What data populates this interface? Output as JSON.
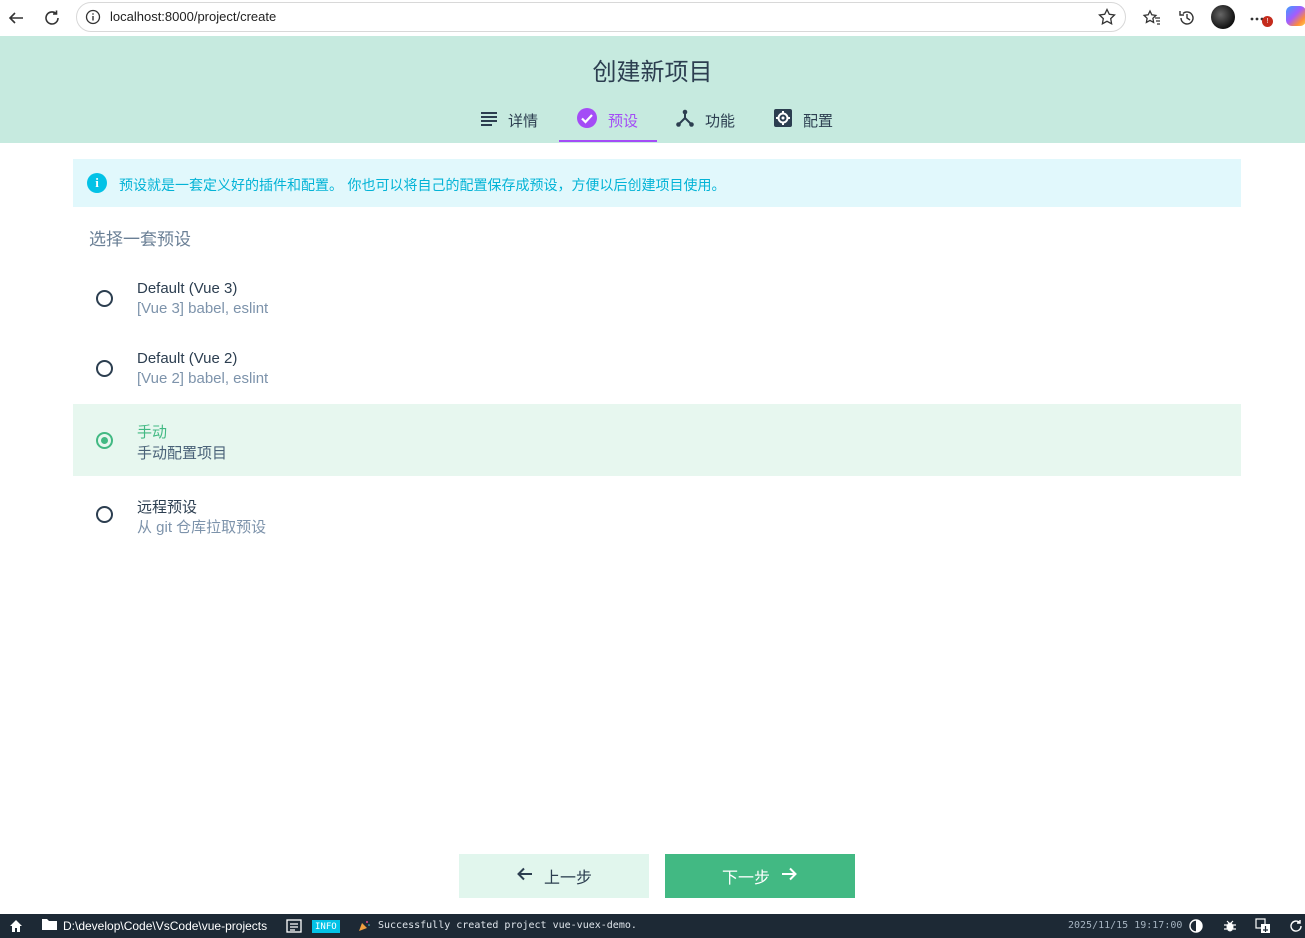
{
  "browser": {
    "url": "localhost:8000/project/create"
  },
  "header": {
    "title": "创建新项目",
    "tabs": [
      {
        "label": "详情",
        "icon": "list-icon",
        "active": false
      },
      {
        "label": "预设",
        "icon": "check-circle-icon",
        "active": true
      },
      {
        "label": "功能",
        "icon": "fork-icon",
        "active": false
      },
      {
        "label": "配置",
        "icon": "settings-icon",
        "active": false
      }
    ]
  },
  "info": {
    "text": "预设就是一套定义好的插件和配置。 你也可以将自己的配置保存成预设，方便以后创建项目使用。"
  },
  "presets": {
    "section_title": "选择一套预设",
    "items": [
      {
        "name": "Default (Vue 3)",
        "description": "[Vue 3] babel, eslint",
        "selected": false
      },
      {
        "name": "Default (Vue 2)",
        "description": "[Vue 2] babel, eslint",
        "selected": false
      },
      {
        "name": "手动",
        "description": "手动配置项目",
        "selected": true
      },
      {
        "name": "远程预设",
        "description": "从 git 仓库拉取预设",
        "selected": false
      }
    ]
  },
  "actions": {
    "prev_label": "上一步",
    "next_label": "下一步"
  },
  "statusbar": {
    "folder": "D:\\develop\\Code\\VsCode\\vue-projects",
    "log_level": "INFO",
    "message": "Successfully created project vue-vuex-demo.",
    "timestamp": "2025/11/15 19:17:00"
  },
  "colors": {
    "accent_green": "#42b983",
    "accent_purple": "#a44cf6",
    "info_cyan": "#03c2e6",
    "header_bg": "#c6eadf",
    "statusbar_bg": "#1d2935"
  }
}
